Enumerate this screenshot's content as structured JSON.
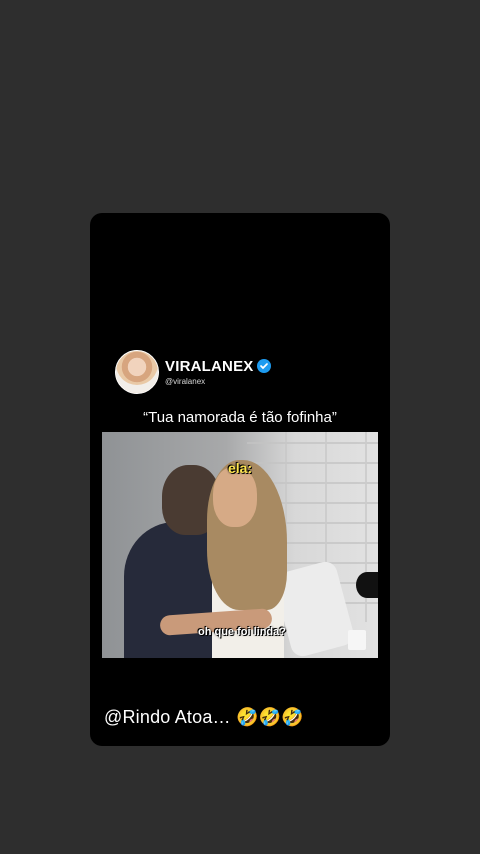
{
  "profile": {
    "display_name": "VIRALANEX",
    "handle": "@viralanex",
    "verified": true
  },
  "post": {
    "quote": "“Tua namorada é tão fofinha”",
    "video_caption_top": "ela:",
    "video_caption_bottom": "oh que foi linda?"
  },
  "story_caption": "@Rindo Atoa… 🤣🤣🤣",
  "icons": {
    "verified": "verified-icon",
    "video": "video-thumbnail"
  },
  "colors": {
    "background": "#2e2e2e",
    "card": "#000000",
    "verified": "#1d9bf0"
  }
}
